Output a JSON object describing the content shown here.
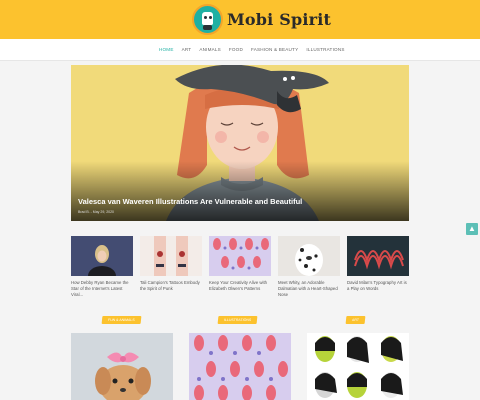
{
  "brand": {
    "name": "Mobi Spirit"
  },
  "nav": {
    "items": [
      {
        "label": "HOME",
        "active": true
      },
      {
        "label": "ART",
        "active": false
      },
      {
        "label": "ANIMALS",
        "active": false
      },
      {
        "label": "FOOD",
        "active": false
      },
      {
        "label": "FASHION & BEAUTY",
        "active": false
      },
      {
        "label": "ILLUSTRATIONS",
        "active": false
      }
    ]
  },
  "hero": {
    "title": "Valesca van Waveren Illustrations Are Vulnerable and Beautiful",
    "meta": "Brad B. - May 29, 2020"
  },
  "tiles": [
    {
      "caption": "How Debby Ryan Became the Star of the Internet's Latest Viral..."
    },
    {
      "caption": "Tali Campion's Tattoos Embody the Spirit of Punk"
    },
    {
      "caption": "Keep Your Creativity Alive with Elizabeth Olwen's Patterns"
    },
    {
      "caption": "Meet Whity, an Adorable Dalmatian with a Heart-Shaped Nose"
    },
    {
      "caption": "David Milan's Typography Art is a Play on Words"
    }
  ],
  "categories": [
    {
      "label": "FUN & ANIMALS"
    },
    {
      "label": "ILLUSTRATIONS"
    },
    {
      "label": "ART"
    }
  ],
  "colors": {
    "brand_yellow": "#fcc22e",
    "accent_teal": "#1fb0a3"
  },
  "icons": {
    "scroll_top": "chevron-up-icon",
    "logo": "robot-logo-icon"
  }
}
